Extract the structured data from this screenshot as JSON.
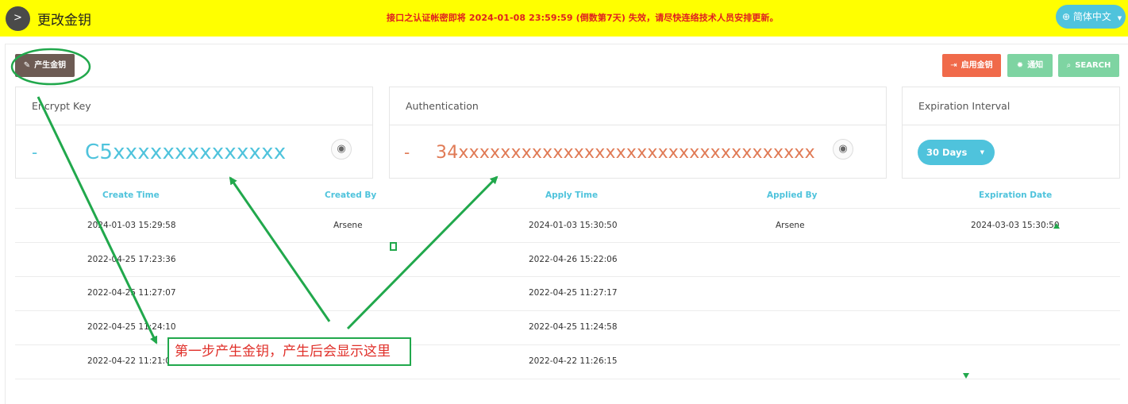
{
  "header": {
    "title": "更改金钥",
    "warning": "接口之认证帐密即将 2024-01-08 23:59:59 (倒数第7天) 失效，请尽快连络技术人员安排更新。",
    "language": "简体中文"
  },
  "toolbar": {
    "generate_label": "产生金钥",
    "enable_label": "启用金钥",
    "notify_label": "通知",
    "search_label": "SEARCH"
  },
  "cards": {
    "encrypt": {
      "title": "Encrypt Key",
      "dash": "-",
      "value": "C5xxxxxxxxxxxxxx",
      "color": "#4fc3dc"
    },
    "auth": {
      "title": "Authentication",
      "dash": "-",
      "value": "34xxxxxxxxxxxxxxxxxxxxxxxxxxxxxxxxxx",
      "color": "#e07a55"
    },
    "expiration": {
      "title": "Expiration Interval",
      "selected": "30 Days"
    }
  },
  "table": {
    "columns": [
      "Create Time",
      "Created By",
      "Apply Time",
      "Applied By",
      "Expiration Date"
    ],
    "rows": [
      [
        "2024-01-03 15:29:58",
        "Arsene",
        "2024-01-03 15:30:50",
        "Arsene",
        "2024-03-03 15:30:50"
      ],
      [
        "2022-04-25 17:23:36",
        "",
        "2022-04-26 15:22:06",
        "",
        ""
      ],
      [
        "2022-04-25 11:27:07",
        "",
        "2022-04-25 11:27:17",
        "",
        ""
      ],
      [
        "2022-04-25 11:24:10",
        "",
        "2022-04-25 11:24:58",
        "",
        ""
      ],
      [
        "2022-04-22 11:21:04",
        "",
        "2022-04-22 11:26:15",
        "",
        ""
      ]
    ]
  },
  "annotation": {
    "text": "第一步产生金钥，产生后会显示这里",
    "color": "#21a84c"
  }
}
